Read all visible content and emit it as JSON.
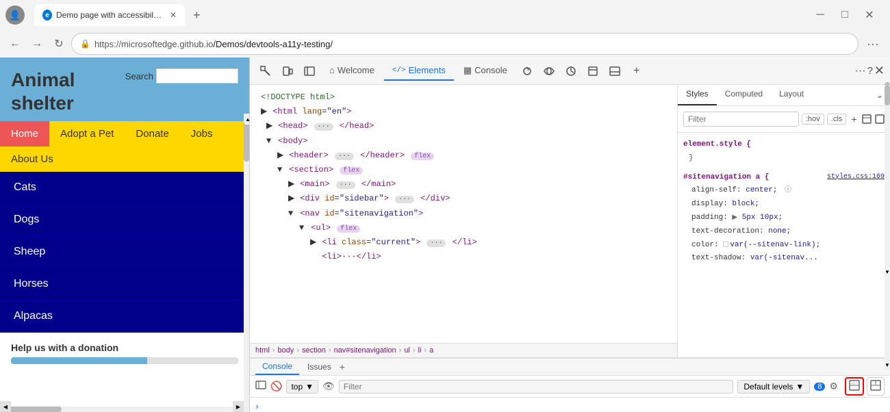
{
  "browser": {
    "tab_title": "Demo page with accessibility issu",
    "tab_icon": "E",
    "url": "https://microsoftedge.github.io/Demos/devtools-a11y-testing/",
    "url_protocol": "https://",
    "url_host": "microsoftedge.github.io",
    "url_path": "/Demos/devtools-a11y-testing/"
  },
  "website": {
    "title_line1": "Animal",
    "title_line2": "shelter",
    "search_label": "Search",
    "nav_items": [
      "Home",
      "Adopt a Pet",
      "Donate",
      "Jobs",
      "About Us"
    ],
    "active_nav": "Home",
    "animal_list": [
      "Cats",
      "Dogs",
      "Sheep",
      "Horses",
      "Alpacas"
    ],
    "donation_text": "Help us with a donation"
  },
  "devtools": {
    "toolbar_tabs": [
      {
        "label": "Welcome",
        "icon": "⌂",
        "active": false
      },
      {
        "label": "Elements",
        "icon": "</>",
        "active": true
      },
      {
        "label": "Console",
        "icon": "▦",
        "active": false
      }
    ],
    "html_tree": [
      {
        "text": "<!DOCTYPE html>",
        "indent": 0
      },
      {
        "text": "<html lang=\"en\">",
        "indent": 0,
        "triangle": "▶"
      },
      {
        "text": "<head>",
        "indent": 1,
        "triangle": "▶",
        "badge": "···"
      },
      {
        "text": "<body>",
        "indent": 0,
        "triangle": "▼"
      },
      {
        "text": "<header>",
        "indent": 1,
        "triangle": "▶",
        "badge": "···",
        "end": "</header>",
        "flex": true
      },
      {
        "text": "<section>",
        "indent": 1,
        "triangle": "▼",
        "flex": true
      },
      {
        "text": "<main>",
        "indent": 2,
        "triangle": "▶",
        "badge": "···",
        "end": "</main>"
      },
      {
        "text": "<div id=\"sidebar\">",
        "indent": 2,
        "triangle": "▶",
        "badge": "···",
        "end": "</div>"
      },
      {
        "text": "<nav id=\"sitenavigation\">",
        "indent": 2,
        "triangle": "▼"
      },
      {
        "text": "<ul>",
        "indent": 3,
        "triangle": "▼",
        "flex": true
      },
      {
        "text": "<li class=\"current\">",
        "indent": 4,
        "triangle": "▶",
        "badge": "···",
        "end": "</li>"
      },
      {
        "text": "<li>···</li>",
        "indent": 4,
        "collapsed": true
      }
    ],
    "breadcrumb": [
      "html",
      "body",
      "section",
      "nav#sitenavigation",
      "ul",
      "li",
      "a"
    ],
    "styles": {
      "tabs": [
        "Styles",
        "Computed",
        "Layout"
      ],
      "active_tab": "Styles",
      "filter_placeholder": "Filter",
      "rules": [
        {
          "selector": "element.style {",
          "properties": []
        },
        {
          "selector": "#sitenavigation a {",
          "source": "styles.css:169",
          "properties": [
            {
              "name": "align-self:",
              "value": "center;",
              "icon": null
            },
            {
              "name": "display:",
              "value": "block;"
            },
            {
              "name": "padding:",
              "value": "▶ 5px 10px;"
            },
            {
              "name": "text-decoration:",
              "value": "none;"
            },
            {
              "name": "color:",
              "value": "var(--sitenav-link);",
              "swatch": true
            },
            {
              "name": "text-shadow:",
              "value": "var(-sitenav..."
            }
          ]
        }
      ]
    },
    "console": {
      "tabs": [
        "Console",
        "Issues"
      ],
      "context": "top",
      "filter_placeholder": "Filter",
      "levels": "Default levels",
      "badge_count": "8"
    }
  }
}
